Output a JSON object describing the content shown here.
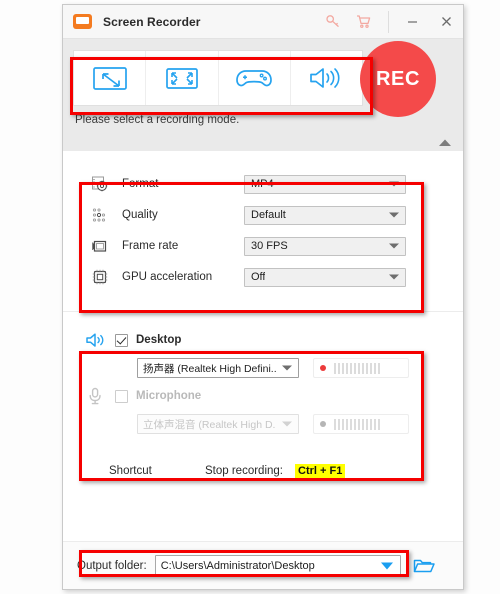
{
  "window": {
    "app_title": "Screen Recorder",
    "logo_icon": "screen-recorder-logo",
    "key_icon": "key-icon",
    "cart_icon": "cart-icon",
    "minimize_icon": "minimize-icon",
    "close_icon": "close-icon"
  },
  "modes": {
    "hint": "Please select a recording mode.",
    "items": [
      {
        "name": "custom-region",
        "icon": "custom-region-icon"
      },
      {
        "name": "full-screen",
        "icon": "full-screen-icon"
      },
      {
        "name": "game-mode",
        "icon": "gamepad-icon"
      },
      {
        "name": "audio-only",
        "icon": "speaker-icon"
      }
    ],
    "record_label": "REC",
    "collapse_icon": "collapse-up-arrow"
  },
  "settings": {
    "rows": [
      {
        "label": "Format",
        "value": "MP4",
        "icon": "format-film-gear-icon"
      },
      {
        "label": "Quality",
        "value": "Default",
        "icon": "quality-dots-icon"
      },
      {
        "label": "Frame rate",
        "value": "30 FPS",
        "icon": "frame-rate-icon"
      },
      {
        "label": "GPU acceleration",
        "value": "Off",
        "icon": "gpu-chip-icon"
      }
    ]
  },
  "audio": {
    "desktop": {
      "label": "Desktop",
      "icon": "speaker-icon",
      "checked": true,
      "device": "扬声器 (Realtek High Defini...",
      "meter_dot_color": "#ec3a3a"
    },
    "microphone": {
      "label": "Microphone",
      "icon": "microphone-icon",
      "checked": false,
      "device": "立体声混音 (Realtek High D...",
      "meter_dot_color": "#b5b5b5"
    }
  },
  "shortcut": {
    "label": "Shortcut",
    "action": "Stop recording:",
    "keys": "Ctrl + F1",
    "highlight_color": "#ffff00"
  },
  "footer": {
    "output_label": "Output folder:",
    "output_path": "C:\\Users\\Administrator\\Desktop",
    "folder_icon": "folder-open-icon"
  },
  "theme": {
    "accent_blue": "#1a9ef0",
    "brand_orange": "#f47b20",
    "record_red": "#f44a4a",
    "annotation_red": "#f50000"
  }
}
